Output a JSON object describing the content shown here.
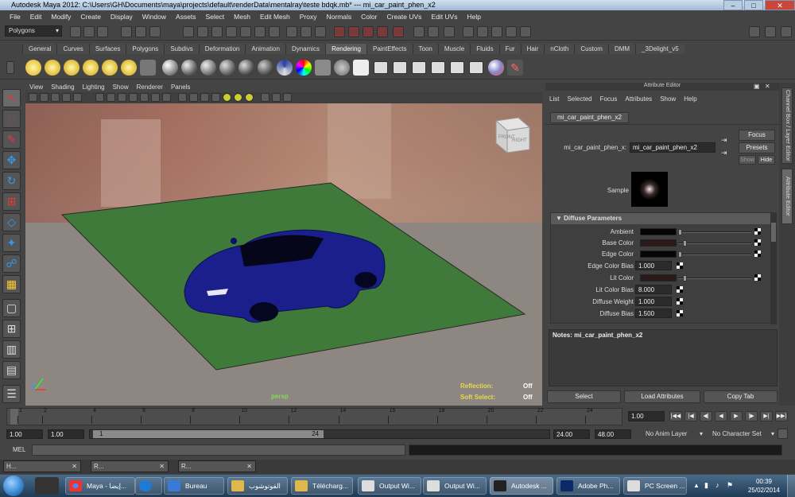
{
  "title_bar": {
    "text": "Autodesk Maya 2012: C:\\Users\\GH\\Documents\\maya\\projects\\default\\renderData\\mentalray\\teste bdqk.mb*   ---   mi_car_paint_phen_x2"
  },
  "main_menu": [
    "File",
    "Edit",
    "Modify",
    "Create",
    "Display",
    "Window",
    "Assets",
    "Select",
    "Mesh",
    "Edit Mesh",
    "Proxy",
    "Normals",
    "Color",
    "Create UVs",
    "Edit UVs",
    "Help"
  ],
  "menu_set": "Polygons",
  "shelf_tabs": [
    "General",
    "Curves",
    "Surfaces",
    "Polygons",
    "Subdivs",
    "Deformation",
    "Animation",
    "Dynamics",
    "Rendering",
    "PaintEffects",
    "Toon",
    "Muscle",
    "Fluids",
    "Fur",
    "Hair",
    "nCloth",
    "Custom",
    "DMM",
    "_3Delight_v5"
  ],
  "active_shelf_tab": "Rendering",
  "panel_menu": [
    "View",
    "Shading",
    "Lighting",
    "Show",
    "Renderer",
    "Panels"
  ],
  "viewport": {
    "camera_label": "persp",
    "view_cube_front": "FRONT",
    "view_cube_right": "RIGHT",
    "reflection_label": "Reflection:",
    "reflection_value": "Off",
    "soft_select_label": "Soft Select:",
    "soft_select_value": "Off",
    "colors": {
      "ground": "#3f7a3a",
      "car": "#1a1f8c"
    }
  },
  "side_tabs": [
    "Channel Box / Layer Editor",
    "Attribute Editor"
  ],
  "attribute_editor": {
    "header": "Attribute Editor",
    "menu": [
      "List",
      "Selected",
      "Focus",
      "Attributes",
      "Show",
      "Help"
    ],
    "node_tab": "mi_car_paint_phen_x2",
    "node_label": "mi_car_paint_phen_x:",
    "node_value": "mi_car_paint_phen_x2",
    "focus_button": "Focus",
    "presets_button": "Presets",
    "show_button": "Show",
    "hide_button": "Hide",
    "sample_label": "Sample",
    "section_title": "Diffuse Parameters",
    "attributes": [
      {
        "label": "Ambient"
      },
      {
        "label": "Base Color"
      },
      {
        "label": "Edge Color"
      },
      {
        "label": "Edge Color Bias",
        "value": "1.000"
      },
      {
        "label": "Lit Color"
      },
      {
        "label": "Lit Color Bias",
        "value": "8.000"
      },
      {
        "label": "Diffuse Weight",
        "value": "1.000"
      },
      {
        "label": "Diffuse Bias",
        "value": "1.500"
      }
    ],
    "notes_label": "Notes:  mi_car_paint_phen_x2",
    "bottom_buttons": [
      "Select",
      "Load Attributes",
      "Copy Tab"
    ]
  },
  "time_slider": {
    "ticks": [
      "1",
      "2",
      "4",
      "6",
      "8",
      "10",
      "12",
      "14",
      "16",
      "18",
      "20",
      "22",
      "24"
    ],
    "current_frame": "1.00"
  },
  "playback_controls": [
    "|◀◀",
    "|◀",
    "◀|",
    "◀",
    "▶",
    "|▶",
    "▶|",
    "▶▶|"
  ],
  "range_slider": {
    "start": "1.00",
    "playback_start": "1.00",
    "range_min": "1",
    "range_max": "24",
    "playback_end": "24.00",
    "end": "48.00",
    "anim_layer": "No Anim Layer",
    "character_set": "No Character Set"
  },
  "command_line": {
    "label": "MEL"
  },
  "minimized_windows": [
    "H...",
    "R...",
    "R..."
  ],
  "taskbar": {
    "items": [
      "Maya - إيضا...",
      "Bureau",
      "الفوتوشوب",
      "Télécharg...",
      "Output Wi...",
      "Output Wi...",
      "Autodesk ...",
      "Adobe Ph...",
      "PC Screen ..."
    ],
    "time": "00:39",
    "date": "25/02/2014",
    "colors": {
      "start": "#3a8ad6"
    }
  }
}
